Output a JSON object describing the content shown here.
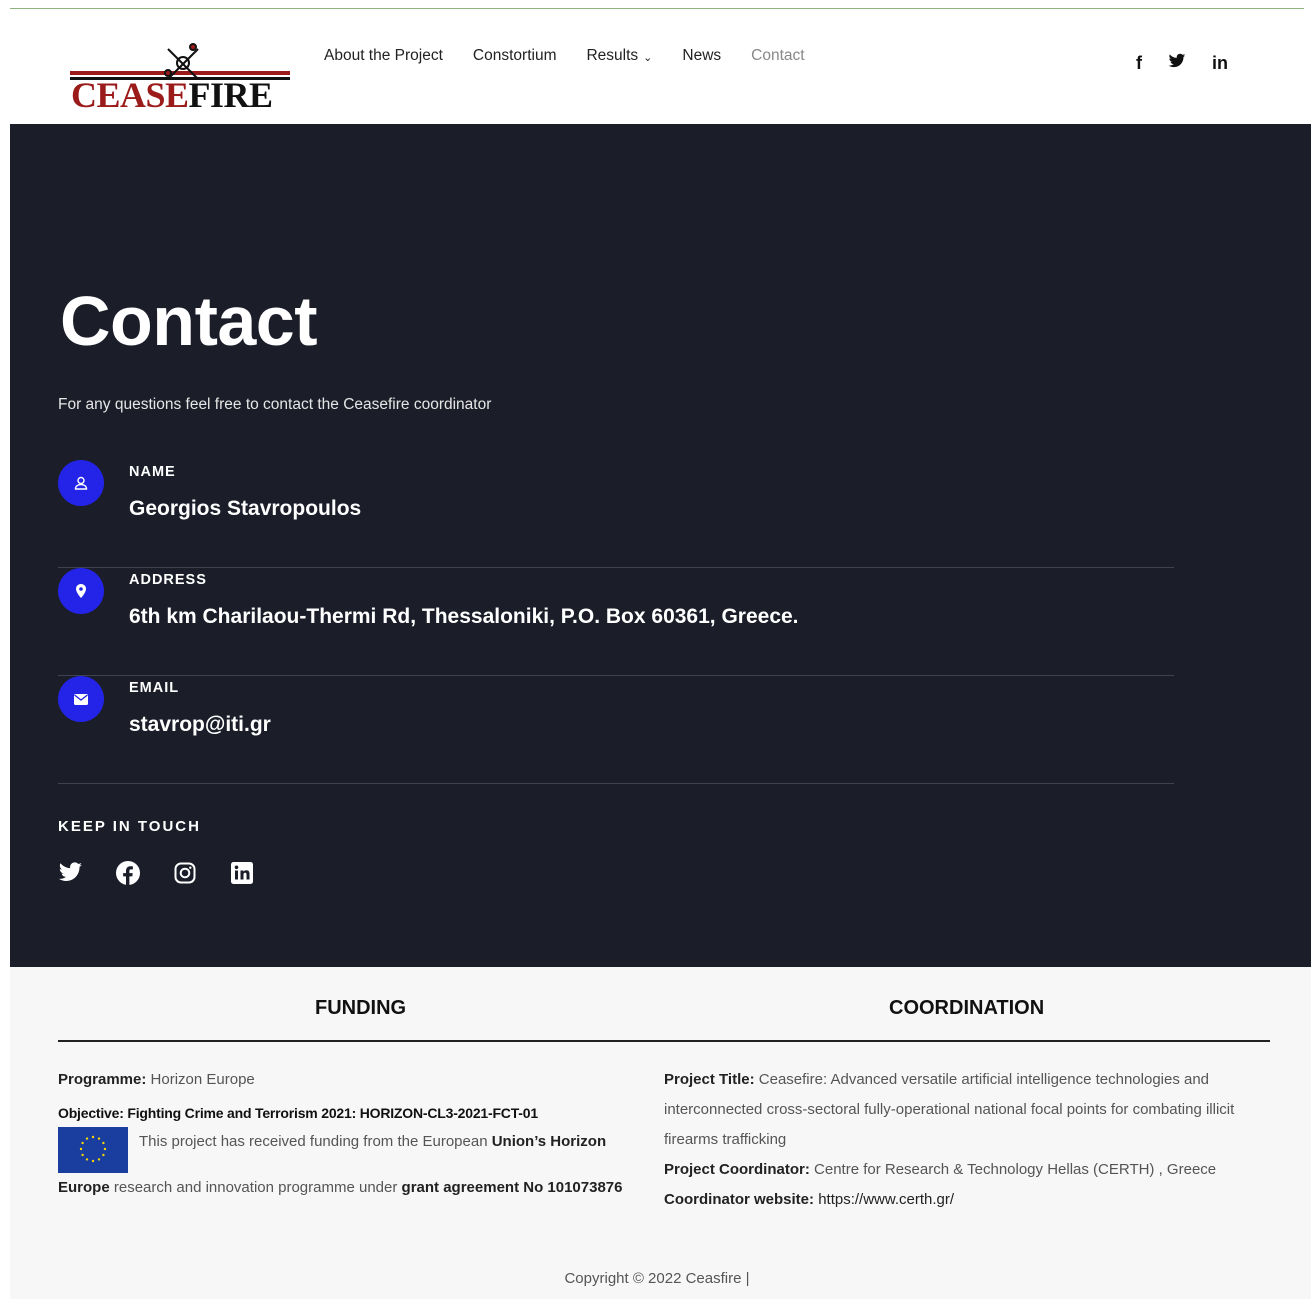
{
  "header": {
    "logo": {
      "text_part1": "CEASE",
      "text_part2": "FIRE"
    },
    "nav": [
      {
        "label": "About the Project"
      },
      {
        "label": "Constortium"
      },
      {
        "label": "Results"
      },
      {
        "label": "News"
      },
      {
        "label": "Contact"
      }
    ],
    "social": [
      "facebook-icon",
      "twitter-icon",
      "linkedin-icon"
    ],
    "social_glyphs": {
      "facebook": "f",
      "twitter": "✦",
      "linkedin": "in"
    }
  },
  "hero": {
    "title": "Contact",
    "subtitle": "For any questions feel free to contact the Ceasefire coordinator",
    "items": [
      {
        "label": "NAME",
        "value": "Georgios Stavropoulos",
        "icon": "user-icon"
      },
      {
        "label": "ADDRESS",
        "value": "6th km Charilaou-Thermi Rd, Thessaloniki, P.O. Box 60361, Greece.",
        "icon": "map-pin-icon"
      },
      {
        "label": "EMAIL",
        "value": "stavrop@iti.gr",
        "icon": "envelope-icon"
      }
    ],
    "keep_in_touch": "KEEP IN TOUCH",
    "social": [
      "twitter-icon",
      "facebook-icon",
      "instagram-icon",
      "linkedin-icon"
    ]
  },
  "footer": {
    "funding": {
      "heading": "FUNDING",
      "programme_label": "Programme:",
      "programme_value": "Horizon Europe",
      "objective": "Objective: Fighting Crime and Terrorism 2021: HORIZON-CL3-2021-FCT-01",
      "text_1": "This project has received funding from the European ",
      "text_bold_1": "Union’s Horizon Europe",
      "text_2": " research and innovation programme under ",
      "text_bold_2": "grant agreement No 101073876"
    },
    "coordination": {
      "heading": "COORDINATION",
      "title_label": "Project Title:",
      "title_value": "Ceasefire: Advanced versatile artificial intelligence technologies and interconnected cross-sectoral fully-operational national focal points for combating illicit firearms trafficking",
      "coordinator_label": "Project Coordinator:",
      "coordinator_value": "Centre for Research & Technology Hellas (CERTH) , Greece",
      "website_label": "Coordinator website:",
      "website_value": "https://www.certh.gr/"
    },
    "copyright": "Copyright © 2022 Ceasfire |"
  },
  "colors": {
    "hero_bg": "#1b1e29",
    "accent_blue": "#2424e8",
    "logo_red": "#9b1b1b"
  }
}
